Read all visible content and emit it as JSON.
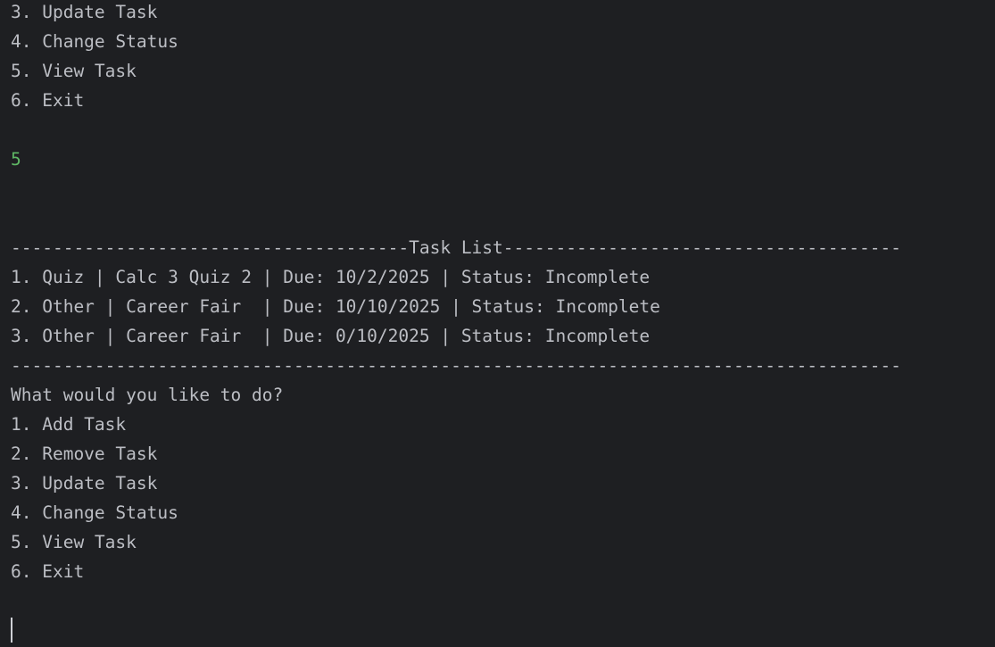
{
  "terminal": {
    "menu_top": [
      "3. Update Task",
      "4. Change Status",
      "5. View Task",
      "6. Exit"
    ],
    "user_input": "5",
    "task_list_header": "--------------------------------------Task List--------------------------------------",
    "tasks": [
      "1. Quiz | Calc 3 Quiz 2 | Due: 10/2/2025 | Status: Incomplete",
      "2. Other | Career Fair  | Due: 10/10/2025 | Status: Incomplete",
      "3. Other | Career Fair  | Due: 0/10/2025 | Status: Incomplete"
    ],
    "task_list_footer": "-------------------------------------------------------------------------------------",
    "prompt": "What would you like to do?",
    "menu": [
      "1. Add Task",
      "2. Remove Task",
      "3. Update Task",
      "4. Change Status",
      "5. View Task",
      "6. Exit"
    ],
    "colors": {
      "background": "#1e1f22",
      "text": "#bcbec4",
      "input_echo": "#5fb865"
    }
  }
}
